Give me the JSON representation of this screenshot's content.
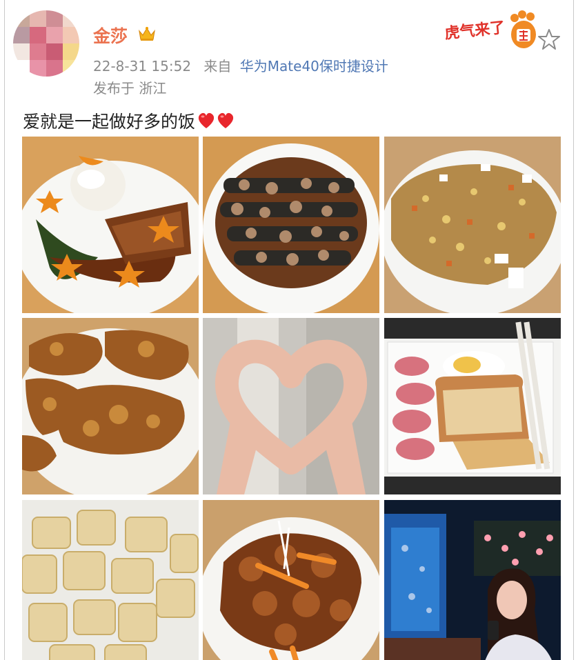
{
  "post": {
    "author": "金莎",
    "timestamp": "22-8-31 15:52",
    "from_label": "来自",
    "device": "华为Mate40保时捷设计",
    "location": "发布于 浙江",
    "text": "爱就是一起做好多的饭",
    "badge_text": "虎气来了"
  },
  "photos": [
    {
      "name": "rice-with-chicken-photo"
    },
    {
      "name": "eggplant-dish-photo"
    },
    {
      "name": "fried-rice-photo"
    },
    {
      "name": "fried-cutlet-photo"
    },
    {
      "name": "hand-heart-photo"
    },
    {
      "name": "toast-breakfast-photo"
    },
    {
      "name": "crispy-tofu-photo"
    },
    {
      "name": "sweet-sour-pork-photo"
    },
    {
      "name": "aquarium-selfie-photo"
    }
  ],
  "colors": {
    "author": "#eb7350",
    "link": "#5078b4",
    "meta": "#8a8a8a",
    "heart": "#e8262c"
  },
  "icons": [
    "crown-icon",
    "tiger-badge-icon",
    "star-icon",
    "heart-emoji-icon"
  ]
}
